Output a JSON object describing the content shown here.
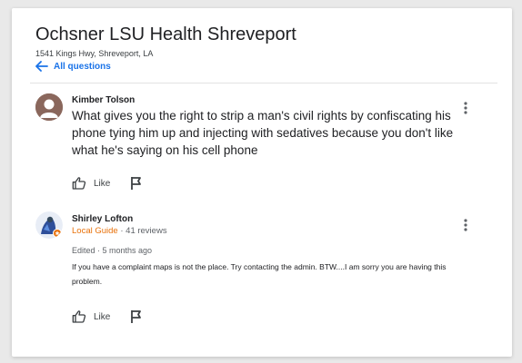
{
  "header": {
    "title": "Ochsner LSU Health Shreveport",
    "address": "1541 Kings Hwy, Shreveport, LA",
    "back_label": "All questions"
  },
  "question": {
    "author": "Kimber Tolson",
    "text": "What gives you the right to strip a man's civil rights by confiscating his phone tying him up and injecting with sedatives because you don't like what he's saying on his cell phone",
    "like_label": "Like"
  },
  "answer": {
    "author": "Shirley Lofton",
    "badge": "Local Guide",
    "separator": " · ",
    "reviews": "41 reviews",
    "edited": "Edited · 5 months ago",
    "text": "If you have a complaint maps is not the place. Try contacting the admin. BTW....I am sorry you are having this problem.",
    "like_label": "Like"
  },
  "colors": {
    "link": "#1a73e8",
    "local_guide": "#e8710a",
    "text_primary": "#202124",
    "text_secondary": "#5f6368"
  },
  "icons": {
    "back": "arrow-left-icon",
    "more": "more-vert-icon",
    "like": "thumb-up-icon",
    "flag": "flag-icon",
    "guide_badge": "local-guide-star-icon"
  }
}
